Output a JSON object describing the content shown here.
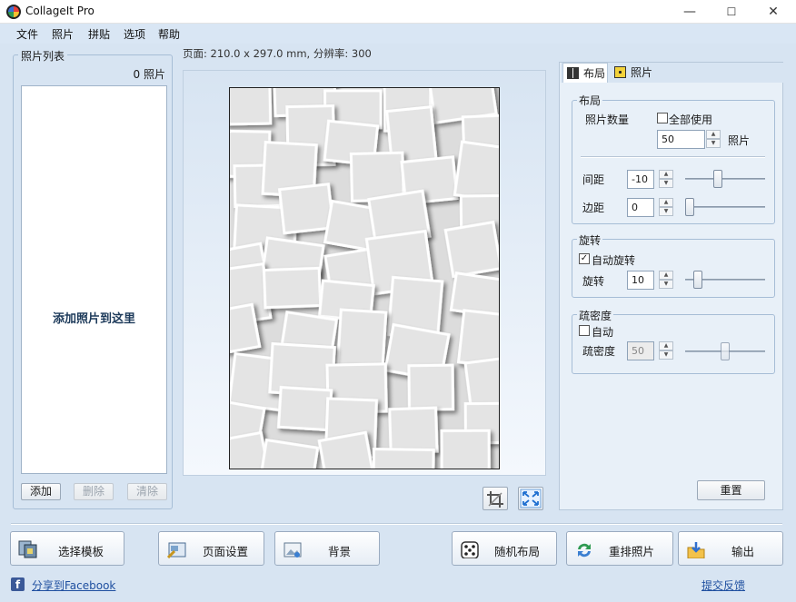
{
  "window": {
    "title": "CollageIt Pro",
    "minimize": "—",
    "maximize": "☐",
    "close": "✕"
  },
  "menu": [
    "文件",
    "照片",
    "拼贴",
    "选项",
    "帮助"
  ],
  "page_info": "页面: 210.0 x 297.0 mm, 分辨率: 300",
  "photo_list": {
    "title": "照片列表",
    "count": "0 照片",
    "hint": "添加照片到这里",
    "add": "添加",
    "delete": "删除",
    "clear": "清除"
  },
  "tabs": {
    "layout": "布局",
    "photos": "照片"
  },
  "layout_group": {
    "title": "布局",
    "photo_count_label": "照片数量",
    "use_all_label": "全部使用",
    "use_all_checked": false,
    "photo_count": "50",
    "photo_unit": "照片",
    "spacing_label": "间距",
    "spacing": "-10",
    "margin_label": "边距",
    "margin": "0"
  },
  "rotation_group": {
    "title": "旋转",
    "auto_label": "自动旋转",
    "auto_checked": true,
    "rotation_label": "旋转",
    "rotation": "10"
  },
  "density_group": {
    "title": "疏密度",
    "auto_label": "自动",
    "auto_checked": false,
    "density_label": "疏密度",
    "density": "50"
  },
  "reset": "重置",
  "bottom": {
    "template": "选择模板",
    "page_setup": "页面设置",
    "background": "背景",
    "random": "随机布局",
    "shuffle": "重排照片",
    "export": "输出"
  },
  "share": "分享到Facebook",
  "feedback": "提交反馈",
  "colors": {
    "accent": "#3b6fd6",
    "panel": "#e8f0f8",
    "window_bg": "#d7e4f2"
  }
}
